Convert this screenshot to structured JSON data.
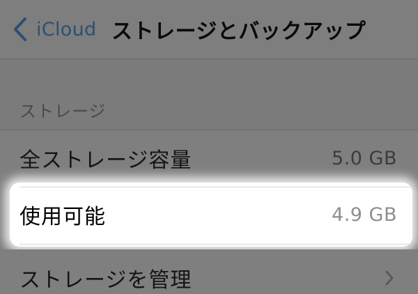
{
  "navbar": {
    "back_label": "iCloud",
    "title": "ストレージとバックアップ",
    "back_icon": "chevron-left-icon"
  },
  "storage_section": {
    "header": "ストレージ",
    "rows": [
      {
        "label": "全ストレージ容量",
        "value": "5.0 GB"
      },
      {
        "label": "使用可能",
        "value": "4.9 GB",
        "highlighted": true
      },
      {
        "label": "ストレージを管理",
        "icon": "chevron-right-icon"
      }
    ]
  },
  "colors": {
    "back_tint": "#2d4f73",
    "overlay_gray": "#7b7b7b",
    "highlight": "#ffffff",
    "value_gray": "#8e8e93"
  }
}
